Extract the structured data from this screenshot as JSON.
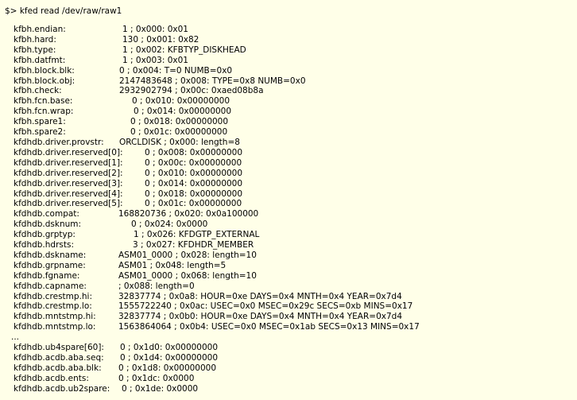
{
  "terminal": {
    "command": "$> kfed read /dev/raw/raw1",
    "ellipsis": "...",
    "entries": [
      {
        "field": "kfbh.endian:",
        "value": "1 ; 0x000: 0x01"
      },
      {
        "field": "kfbh.hard:",
        "value": "130 ; 0x001: 0x82"
      },
      {
        "field": "kfbh.type:",
        "value": "1 ; 0x002: KFBTYP_DISKHEAD"
      },
      {
        "field": "kfbh.datfmt:",
        "value": "1 ; 0x003: 0x01"
      },
      {
        "field": "kfbh.block.blk:",
        "value": "0 ; 0x004: T=0 NUMB=0x0"
      },
      {
        "field": "kfbh.block.obj:",
        "value": "2147483648 ; 0x008: TYPE=0x8 NUMB=0x0"
      },
      {
        "field": "kfbh.check:",
        "value": "2932902794 ; 0x00c: 0xaed08b8a"
      },
      {
        "field": "kfbh.fcn.base:",
        "value": "0 ; 0x010: 0x00000000"
      },
      {
        "field": "kfbh.fcn.wrap:",
        "value": "0 ; 0x014: 0x00000000"
      },
      {
        "field": "kfbh.spare1:",
        "value": "0 ; 0x018: 0x00000000"
      },
      {
        "field": "kfbh.spare2:",
        "value": "0 ; 0x01c: 0x00000000"
      },
      {
        "field": "kfdhdb.driver.provstr:",
        "value": "ORCLDISK ; 0x000: length=8"
      },
      {
        "field": "kfdhdb.driver.reserved[0]:",
        "value": "0 ; 0x008: 0x00000000"
      },
      {
        "field": "kfdhdb.driver.reserved[1]:",
        "value": "0 ; 0x00c: 0x00000000"
      },
      {
        "field": "kfdhdb.driver.reserved[2]:",
        "value": "0 ; 0x010: 0x00000000"
      },
      {
        "field": "kfdhdb.driver.reserved[3]:",
        "value": "0 ; 0x014: 0x00000000"
      },
      {
        "field": "kfdhdb.driver.reserved[4]:",
        "value": "0 ; 0x018: 0x00000000"
      },
      {
        "field": "kfdhdb.driver.reserved[5]:",
        "value": "0 ; 0x01c: 0x00000000"
      },
      {
        "field": "kfdhdb.compat:",
        "value": "168820736 ; 0x020: 0x0a100000"
      },
      {
        "field": "kfdhdb.dsknum:",
        "value": "0 ; 0x024: 0x0000"
      },
      {
        "field": "kfdhdb.grptyp:",
        "value": "1 ; 0x026: KFDGTP_EXTERNAL"
      },
      {
        "field": "kfdhdb.hdrsts:",
        "value": "3 ; 0x027: KFDHDR_MEMBER"
      },
      {
        "field": "kfdhdb.dskname:",
        "value": "ASM01_0000 ; 0x028: length=10"
      },
      {
        "field": "kfdhdb.grpname:",
        "value": "ASM01 ; 0x048: length=5"
      },
      {
        "field": "kfdhdb.fgname:",
        "value": "ASM01_0000 ; 0x068: length=10"
      },
      {
        "field": "kfdhdb.capname:",
        "value": "; 0x088: length=0"
      },
      {
        "field": "kfdhdb.crestmp.hi:",
        "value": "32837774 ; 0x0a8: HOUR=0xe DAYS=0x4 MNTH=0x4 YEAR=0x7d4"
      },
      {
        "field": "kfdhdb.crestmp.lo:",
        "value": "1555722240 ; 0x0ac: USEC=0x0 MSEC=0x29c SECS=0xb MINS=0x17"
      },
      {
        "field": "kfdhdb.mntstmp.hi:",
        "value": "32837774 ; 0x0b0: HOUR=0xe DAYS=0x4 MNTH=0x4 YEAR=0x7d4"
      },
      {
        "field": "kfdhdb.mntstmp.lo:",
        "value": "1563864064 ; 0x0b4: USEC=0x0 MSEC=0x1ab SECS=0x13 MINS=0x17"
      }
    ],
    "entries_after": [
      {
        "field": "kfdhdb.ub4spare[60]:",
        "value": "0 ; 0x1d0: 0x00000000"
      },
      {
        "field": "kfdhdb.acdb.aba.seq:",
        "value": "0 ; 0x1d4: 0x00000000"
      },
      {
        "field": "kfdhdb.acdb.aba.blk:",
        "value": "0 ; 0x1d8: 0x00000000"
      },
      {
        "field": "kfdhdb.acdb.ents:",
        "value": "0 ; 0x1dc: 0x0000"
      },
      {
        "field": "kfdhdb.acdb.ub2spare:",
        "value": "0 ; 0x1de: 0x0000"
      }
    ]
  }
}
